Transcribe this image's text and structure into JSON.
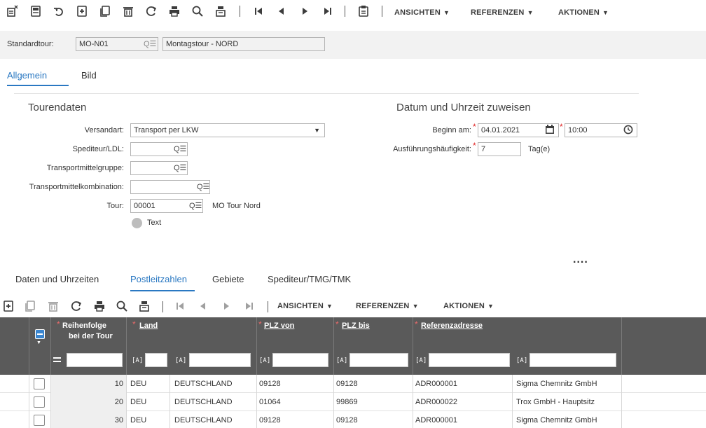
{
  "toolbar": {
    "menus": [
      "ANSICHTEN",
      "REFERENZEN",
      "AKTIONEN"
    ]
  },
  "header": {
    "standardtour_label": "Standardtour:",
    "standardtour_value": "MO-N01",
    "description_value": "Montagstour - NORD"
  },
  "main_tabs": [
    "Allgemein",
    "Bild"
  ],
  "tourendaten": {
    "title": "Tourendaten",
    "versandart_label": "Versandart:",
    "versandart_value": "Transport per LKW",
    "spediteur_label": "Spediteur/LDL:",
    "transportmittelgruppe_label": "Transportmittelgruppe:",
    "transportmittelkombination_label": "Transportmittelkombination:",
    "tour_label": "Tour:",
    "tour_value": "00001",
    "tour_name": "MO Tour Nord",
    "text_label": "Text"
  },
  "datum": {
    "title": "Datum und Uhrzeit zuweisen",
    "beginn_label": "Beginn am:",
    "beginn_date": "04.01.2021",
    "beginn_time": "10:00",
    "haeufigkeit_label": "Ausführungshäufigkeit:",
    "haeufigkeit_value": "7",
    "haeufigkeit_unit": "Tag(e)",
    "more": "...."
  },
  "sub_tabs": [
    "Daten und Uhrzeiten",
    "Postleitzahlen",
    "Gebiete",
    "Spediteur/TMG/TMK"
  ],
  "grid_toolbar": {
    "menus": [
      "ANSICHTEN",
      "REFERENZEN",
      "AKTIONEN"
    ]
  },
  "grid": {
    "columns": {
      "reihenfolge_1": "Reihenfolge",
      "reihenfolge_2": "bei der Tour",
      "land": "Land",
      "plz_von": "PLZ von",
      "plz_bis": "PLZ bis",
      "referenzadresse": "Referenzadresse"
    },
    "filter_marker": "[A]",
    "rows": [
      {
        "seq": "10",
        "code": "DEU",
        "land": "DEUTSCHLAND",
        "plz_von": "09128",
        "plz_bis": "09128",
        "ref": "ADR000001",
        "name": "Sigma Chemnitz GmbH"
      },
      {
        "seq": "20",
        "code": "DEU",
        "land": "DEUTSCHLAND",
        "plz_von": "01064",
        "plz_bis": "99869",
        "ref": "ADR000022",
        "name": "Trox GmbH - Hauptsitz"
      },
      {
        "seq": "30",
        "code": "DEU",
        "land": "DEUTSCHLAND",
        "plz_von": "09128",
        "plz_bis": "09128",
        "ref": "ADR000001",
        "name": "Sigma Chemnitz GmbH"
      }
    ]
  },
  "colors": {
    "accent": "#2a78c2",
    "required": "#e02020",
    "grid_header": "#5a5a5a"
  }
}
